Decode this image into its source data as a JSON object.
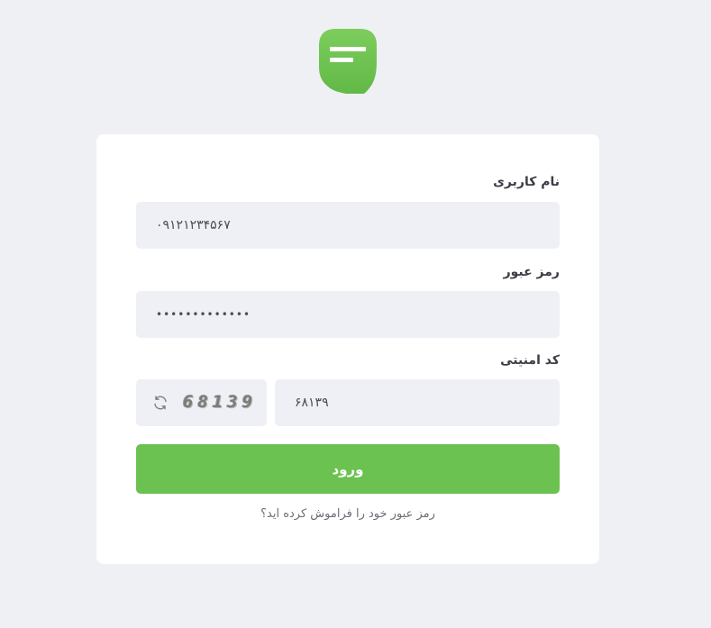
{
  "logo": {
    "icon": "chat-bubble-icon",
    "color": "#6cc250"
  },
  "form": {
    "username_label": "نام کاربری",
    "username_value": "۰۹۱۲۱۲۳۴۵۶۷",
    "password_label": "رمز عبور",
    "password_value": "•••••••••••••",
    "captcha_label": "کد امنیتی",
    "captcha_code": "68139",
    "captcha_value": "۶۸۱۳۹",
    "refresh_icon": "refresh-icon",
    "submit_label": "ورود",
    "forgot_link": "رمز عبور خود را فراموش کرده اید؟"
  },
  "colors": {
    "accent": "#6cc250",
    "background": "#eff0f4",
    "field": "#eff0f5"
  }
}
